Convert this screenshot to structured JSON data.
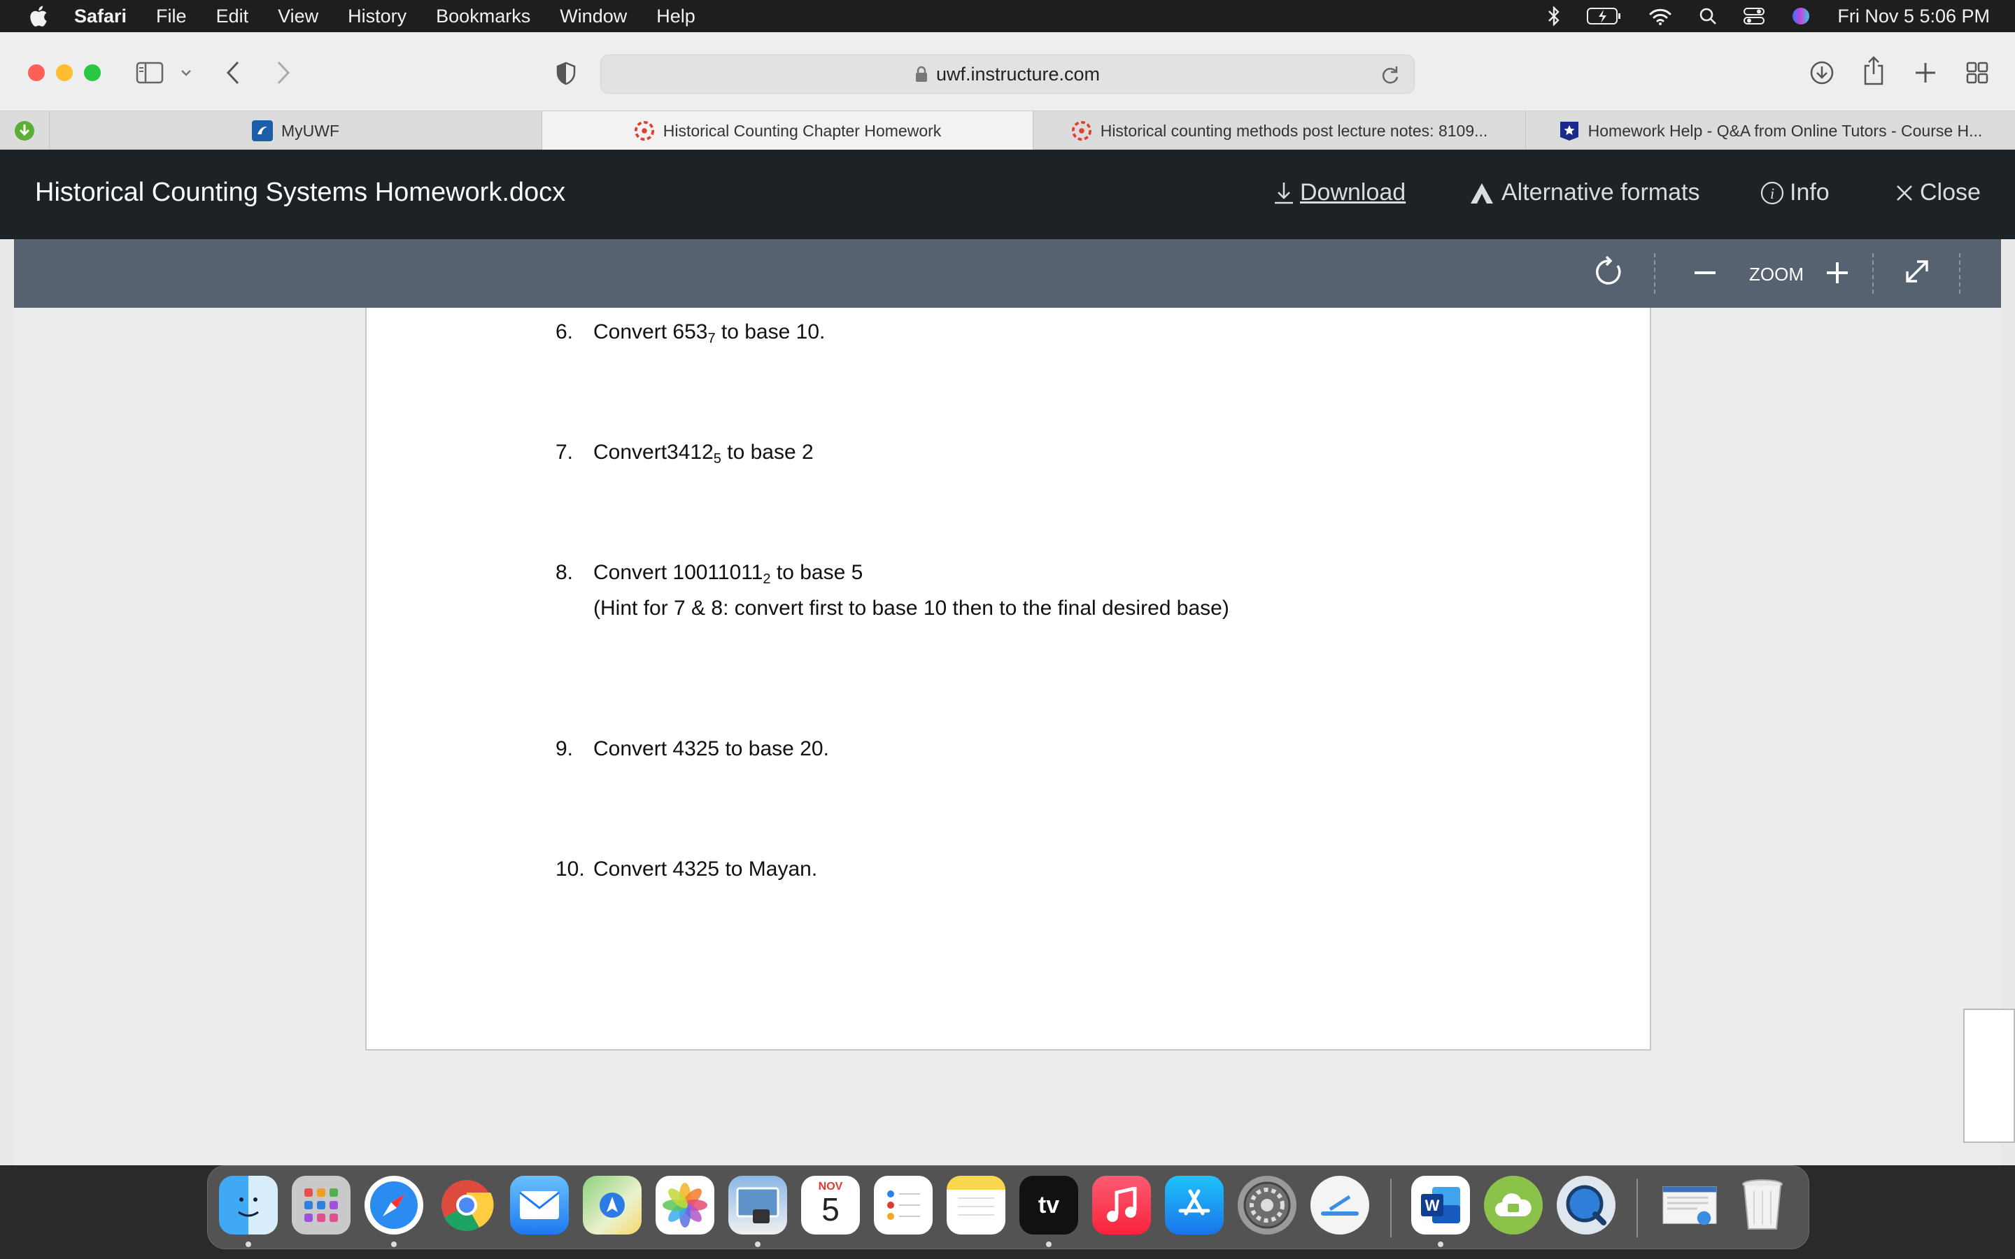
{
  "menubar": {
    "app": "Safari",
    "items": [
      "File",
      "Edit",
      "View",
      "History",
      "Bookmarks",
      "Window",
      "Help"
    ],
    "clock": "Fri Nov 5  5:06 PM"
  },
  "browser": {
    "url": "uwf.instructure.com",
    "tabs": [
      {
        "label": "MyUWF",
        "icon": "myuwf-favicon"
      },
      {
        "label": "Historical Counting Chapter Homework",
        "icon": "canvas-favicon"
      },
      {
        "label": "Historical counting methods post lecture notes: 8109...",
        "icon": "canvas-favicon"
      },
      {
        "label": "Homework Help - Q&A from Online Tutors - Course H...",
        "icon": "coursehero-favicon"
      }
    ]
  },
  "viewer": {
    "title": "Historical Counting Systems Homework.docx",
    "download": "Download",
    "alt_formats": "Alternative formats",
    "info": "Info",
    "close": "Close",
    "zoom_label": "ZOOM"
  },
  "document": {
    "questions": [
      {
        "num": "6.",
        "pre": "Convert 653",
        "sub": "7",
        "post": " to base 10."
      },
      {
        "num": "7.",
        "pre": "Convert3412",
        "sub": "5",
        "post": " to base 2"
      },
      {
        "num": "8.",
        "pre": "Convert 10011011",
        "sub": "2",
        "post": " to base 5",
        "hint": "(Hint for 7 & 8: convert first to base 10 then to the final desired base)"
      },
      {
        "num": "9.",
        "pre": "Convert 4325 to base 20.",
        "sub": "",
        "post": ""
      },
      {
        "num": "10.",
        "pre": "Convert 4325 to Mayan.",
        "sub": "",
        "post": ""
      }
    ]
  },
  "dock": {
    "calendar_month": "NOV",
    "calendar_day": "5",
    "tv_label": "tv",
    "word_label": "W"
  }
}
